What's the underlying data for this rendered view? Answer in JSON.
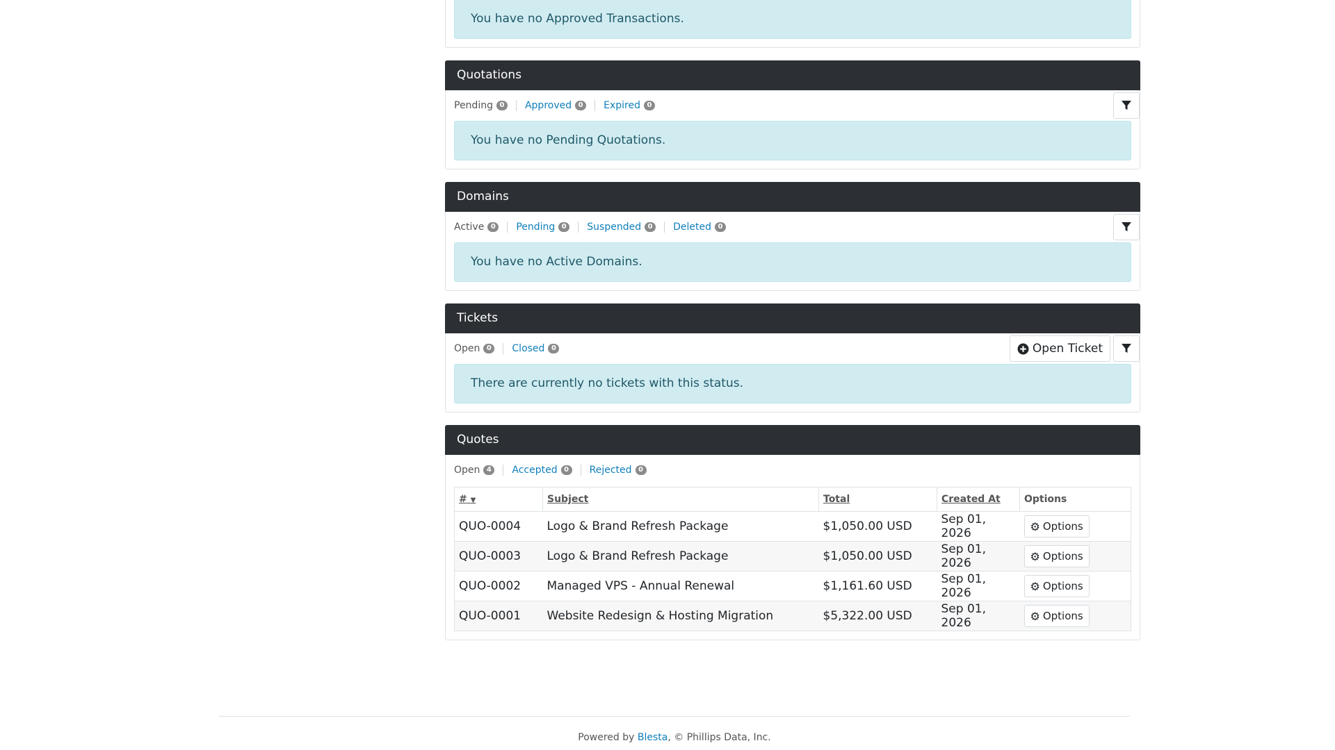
{
  "transactions": {
    "alert": "You have no Approved Transactions."
  },
  "quotations": {
    "title": "Quotations",
    "tabs": [
      {
        "label": "Pending",
        "count": "0"
      },
      {
        "label": "Approved",
        "count": "0"
      },
      {
        "label": "Expired",
        "count": "0"
      }
    ],
    "alert": "You have no Pending Quotations."
  },
  "domains": {
    "title": "Domains",
    "tabs": [
      {
        "label": "Active",
        "count": "0"
      },
      {
        "label": "Pending",
        "count": "0"
      },
      {
        "label": "Suspended",
        "count": "0"
      },
      {
        "label": "Deleted",
        "count": "0"
      }
    ],
    "alert": "You have no Active Domains."
  },
  "tickets": {
    "title": "Tickets",
    "tabs": [
      {
        "label": "Open",
        "count": "0"
      },
      {
        "label": "Closed",
        "count": "0"
      }
    ],
    "open_ticket_label": "Open Ticket",
    "alert": "There are currently no tickets with this status."
  },
  "quotes": {
    "title": "Quotes",
    "tabs": [
      {
        "label": "Open",
        "count": "4"
      },
      {
        "label": "Accepted",
        "count": "0"
      },
      {
        "label": "Rejected",
        "count": "0"
      }
    ],
    "columns": {
      "id": "#",
      "subject": "Subject",
      "total": "Total",
      "created": "Created At",
      "options": "Options"
    },
    "rows": [
      {
        "id": "QUO-0004",
        "subject": "Logo & Brand Refresh Package",
        "total": "$1,050.00 USD",
        "created": "Sep 01, 2026",
        "options": "Options"
      },
      {
        "id": "QUO-0003",
        "subject": "Logo & Brand Refresh Package",
        "total": "$1,050.00 USD",
        "created": "Sep 01, 2026",
        "options": "Options"
      },
      {
        "id": "QUO-0002",
        "subject": "Managed VPS - Annual Renewal",
        "total": "$1,161.60 USD",
        "created": "Sep 01, 2026",
        "options": "Options"
      },
      {
        "id": "QUO-0001",
        "subject": "Website Redesign & Hosting Migration",
        "total": "$5,322.00 USD",
        "created": "Sep 01, 2026",
        "options": "Options"
      }
    ]
  },
  "footer": {
    "prefix": "Powered by",
    "link": "Blesta",
    "suffix": ", © Phillips Data, Inc."
  },
  "icons": {
    "filter": "filter-icon",
    "plus": "plus-circle-icon",
    "gear": "gear-icon",
    "sort": "caret-down-icon"
  }
}
